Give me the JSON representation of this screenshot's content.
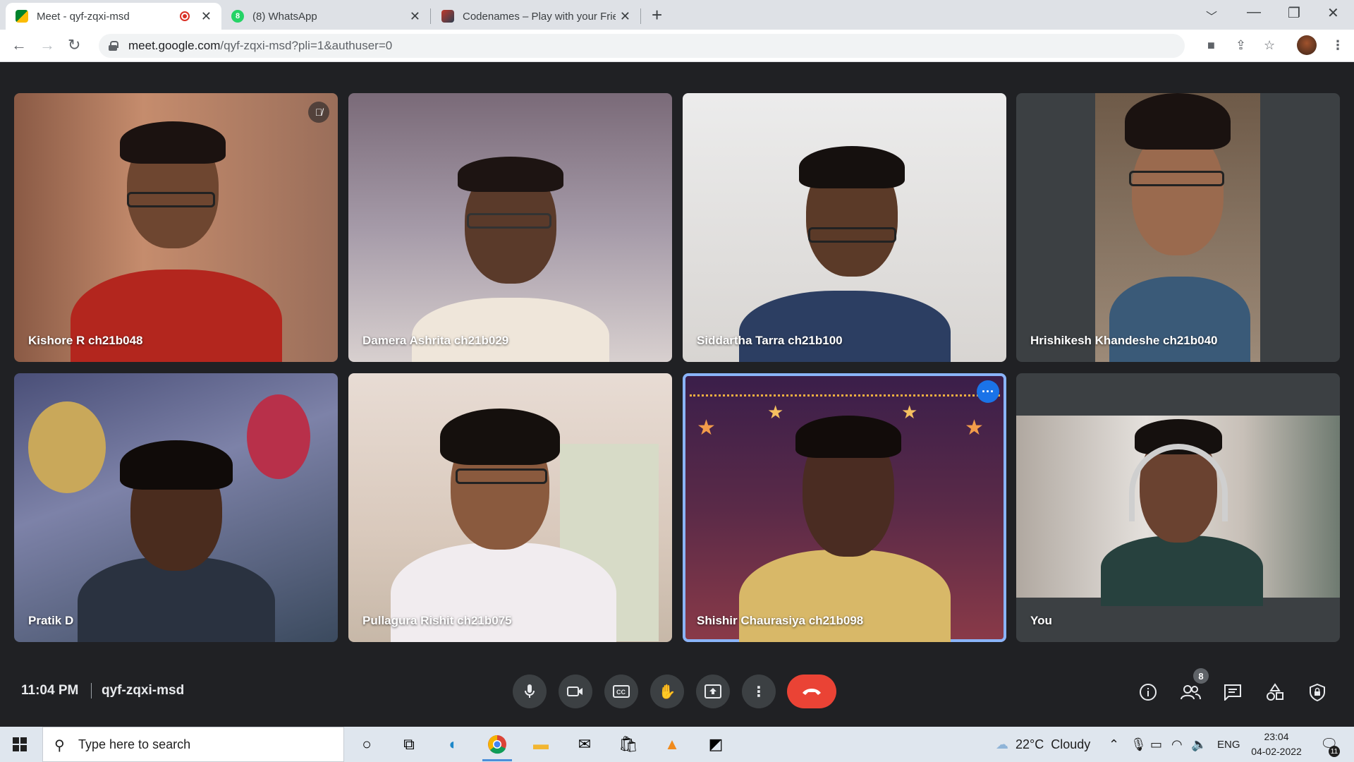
{
  "browser": {
    "tabs": [
      {
        "title": "Meet - qyf-zqxi-msd",
        "favicon": "google-meet-icon"
      },
      {
        "title": "(8) WhatsApp",
        "favicon": "whatsapp-icon"
      },
      {
        "title": "Codenames – Play with your Frie",
        "favicon": "codenames-icon"
      }
    ],
    "url_host": "meet.google.com",
    "url_path": "/qyf-zqxi-msd?pli=1&authuser=0"
  },
  "meet": {
    "participants": [
      {
        "name": "Kishore R ch21b048",
        "muted": true
      },
      {
        "name": "Damera Ashrita ch21b029"
      },
      {
        "name": "Siddartha Tarra ch21b100"
      },
      {
        "name": "Hrishikesh Khandeshe ch21b040"
      },
      {
        "name": "Pratik D"
      },
      {
        "name": "Pullagura Rishit ch21b075"
      },
      {
        "name": "Shishir Chaurasiya ch21b098",
        "speaking": true
      },
      {
        "name": "You"
      }
    ],
    "time": "11:04 PM",
    "meeting_code": "qyf-zqxi-msd",
    "people_count": "8",
    "end_call_color": "#ea4335",
    "accent_color": "#1a73e8"
  },
  "taskbar": {
    "search_placeholder": "Type here to search",
    "weather": "22°C  Cloudy",
    "language": "ENG",
    "clock_time": "23:04",
    "clock_date": "04-02-2022",
    "notification_count": "11"
  }
}
